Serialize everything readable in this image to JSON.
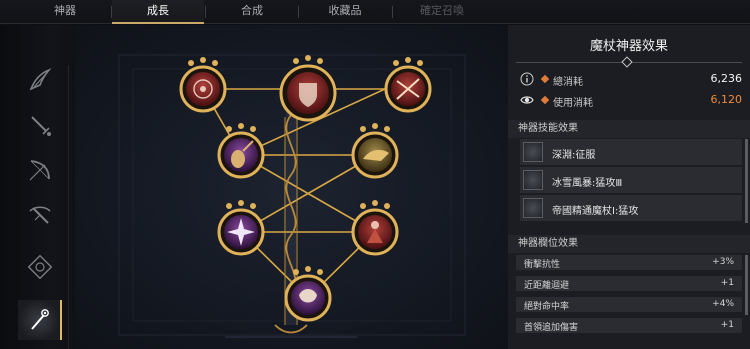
{
  "tabs": [
    "神器",
    "成長",
    "合成",
    "收藏品",
    "確定召喚"
  ],
  "active_tab": 1,
  "panel": {
    "title": "魔杖神器效果",
    "stats": [
      {
        "label": "總消耗",
        "value": "6,236",
        "icon": "info-icon"
      },
      {
        "label": "使用消耗",
        "value": "6,120",
        "icon": "eye-icon",
        "color": "#ef8b3c"
      }
    ],
    "skills_header": "神器技能效果",
    "skills": [
      {
        "label": "深淵:征服",
        "icon": "abyss-skill-icon"
      },
      {
        "label": "冰雪風暴:猛攻Ⅲ",
        "icon": "snowstorm-skill-icon"
      },
      {
        "label": "帝國精通魔杖Ⅰ:猛攻",
        "icon": "staff-skill-icon"
      }
    ],
    "attrs_header": "神器欄位效果",
    "attrs": [
      {
        "name": "衝擊抗性",
        "value": "+3%"
      },
      {
        "name": "近距離迴避",
        "value": "+1"
      },
      {
        "name": "絕對命中率",
        "value": "+4%"
      },
      {
        "name": "首領追加傷害",
        "value": "+1"
      }
    ]
  },
  "rail_icons": [
    "claw-icon",
    "sword-icon",
    "bow-icon",
    "crossbow-icon",
    "orb-icon",
    "staff-icon"
  ],
  "tree_nodes": [
    {
      "name": "shield-crest-node",
      "color": "#7a1d1d"
    },
    {
      "name": "compass-node",
      "color": "#7a1d1d"
    },
    {
      "name": "crossed-arrows-node",
      "color": "#7a1d1d"
    },
    {
      "name": "lute-node",
      "color": "#5b2a6a"
    },
    {
      "name": "golden-horn-node",
      "color": "#6b5a2a"
    },
    {
      "name": "starburst-node",
      "color": "#4a2a6a"
    },
    {
      "name": "red-figure-node",
      "color": "#6a1d1d"
    },
    {
      "name": "flower-node",
      "color": "#4a2a6a"
    }
  ],
  "colors": {
    "accent": "#c9a86a",
    "gold_line": "#d9a845",
    "highlight_orange": "#ef8b3c"
  }
}
